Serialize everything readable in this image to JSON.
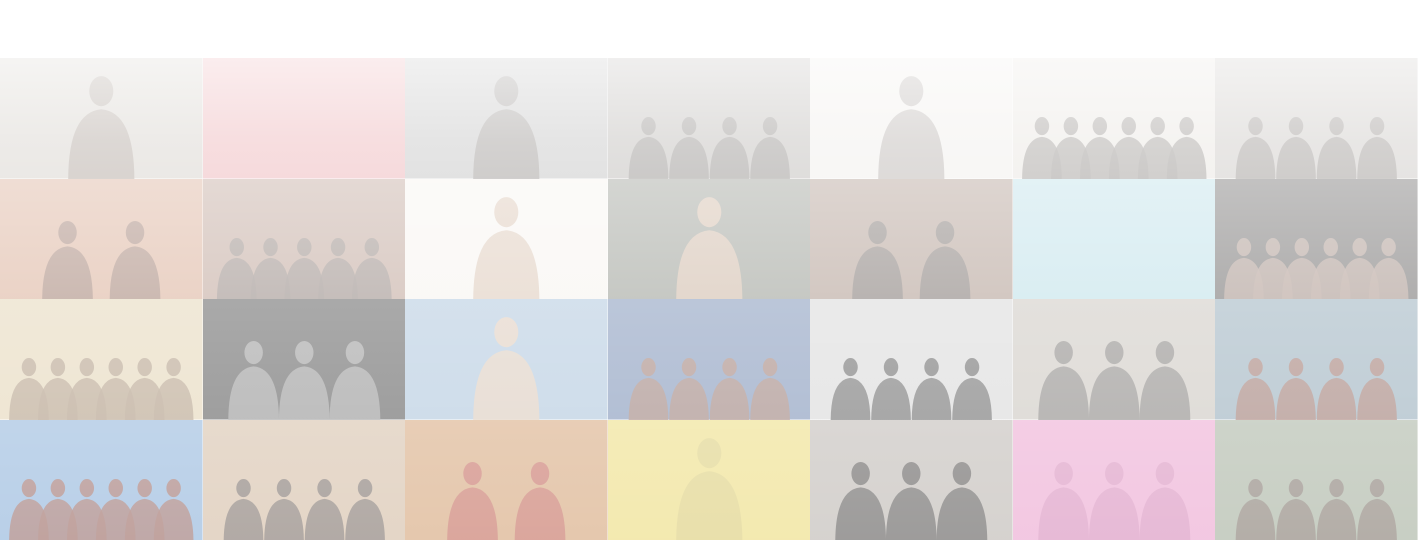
{
  "gallery": {
    "columns": 7,
    "rows": 4,
    "tiles": [
      {
        "subject": "portrait-woman-curly-hair",
        "bg": "#b9b1a6",
        "fg": "#6e5c4e",
        "people": 1
      },
      {
        "subject": "solid-color-card",
        "bg": "#e07f86",
        "fg": "#e07f86",
        "people": 0
      },
      {
        "subject": "portrait-woman-long-hair",
        "bg": "#9b9b9b",
        "fg": "#4d4540",
        "people": 1
      },
      {
        "subject": "band-group-photo",
        "bg": "#8f8a84",
        "fg": "#3f3834",
        "people": 4
      },
      {
        "subject": "guitarist-light-background",
        "bg": "#e6e2dc",
        "fg": "#7a706a",
        "people": 1
      },
      {
        "subject": "band-with-balloons",
        "bg": "#d9d3ca",
        "fg": "#4c453f",
        "people": 6
      },
      {
        "subject": "band-group-photo",
        "bg": "#a8a29c",
        "fg": "#4b433d",
        "people": 4
      },
      {
        "subject": "two-women-singing",
        "bg": "#c98b6a",
        "fg": "#6b3d2c",
        "people": 2
      },
      {
        "subject": "band-against-wall",
        "bg": "#a17b6a",
        "fg": "#5d4c45",
        "people": 5
      },
      {
        "subject": "portrait-blonde-woman",
        "bg": "#f3eee8",
        "fg": "#c6a48a",
        "people": 1
      },
      {
        "subject": "masked-figure-garden",
        "bg": "#6a6f63",
        "fg": "#c49f80",
        "people": 1
      },
      {
        "subject": "two-people-sofa",
        "bg": "#8b6e5e",
        "fg": "#3a302b",
        "people": 2
      },
      {
        "subject": "solid-light-blue",
        "bg": "#9ed1dd",
        "fg": "#9ed1dd",
        "people": 0
      },
      {
        "subject": "band-dark-background",
        "bg": "#2d2a29",
        "fg": "#8a6a5c",
        "people": 6
      },
      {
        "subject": "band-in-field",
        "bg": "#d9c59a",
        "fg": "#8b6d4e",
        "people": 6
      },
      {
        "subject": "trio-black-background",
        "bg": "#1e1e1e",
        "fg": "#777777",
        "people": 3
      },
      {
        "subject": "man-sunglasses-blue-sky",
        "bg": "#8fb0cf",
        "fg": "#d7b79a",
        "people": 1
      },
      {
        "subject": "band-blue-background",
        "bg": "#4d6a9c",
        "fg": "#7d4a3a",
        "people": 4
      },
      {
        "subject": "band-black-and-white",
        "bg": "#c9c9c9",
        "fg": "#1a1a1a",
        "people": 4
      },
      {
        "subject": "street-scene-band",
        "bg": "#b7b0a6",
        "fg": "#4e4a47",
        "people": 3
      },
      {
        "subject": "band-in-blue-field",
        "bg": "#6f8ea1",
        "fg": "#7a3c2d",
        "people": 4
      },
      {
        "subject": "band-blue-sky",
        "bg": "#6d9ccf",
        "fg": "#7e3d33",
        "people": 6
      },
      {
        "subject": "band-wooden-wall",
        "bg": "#c7a98a",
        "fg": "#4b3e37",
        "people": 4
      },
      {
        "subject": "studio-red-hood",
        "bg": "#c98c55",
        "fg": "#b0392d",
        "people": 2
      },
      {
        "subject": "solid-yellow-card",
        "bg": "#e6d25a",
        "fg": "#cdbb4f",
        "people": 1
      },
      {
        "subject": "band-sitting-steps",
        "bg": "#a9a29b",
        "fg": "#1f1c1b",
        "people": 3
      },
      {
        "subject": "solid-pink-card",
        "bg": "#e58cc2",
        "fg": "#c96aa6",
        "people": 3
      },
      {
        "subject": "band-in-woods",
        "bg": "#8c9a83",
        "fg": "#5a4a40",
        "people": 4
      }
    ]
  }
}
